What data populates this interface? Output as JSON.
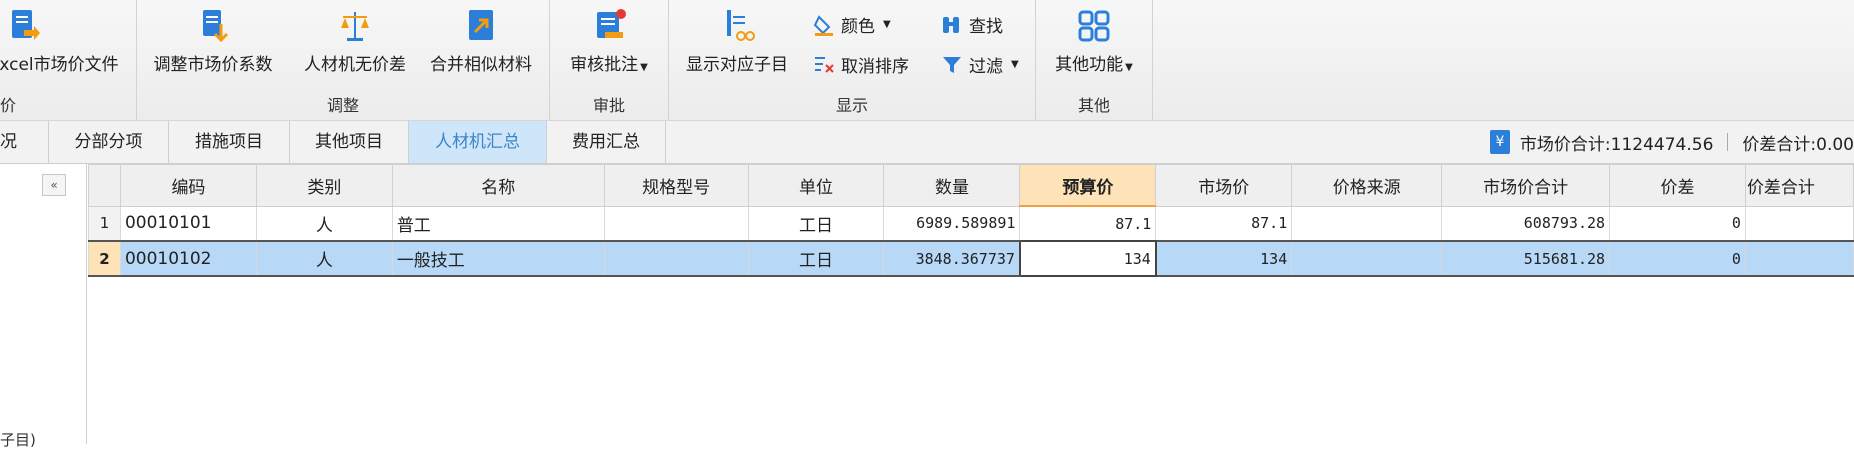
{
  "ribbon": {
    "groups": [
      {
        "title": "价"
      },
      {
        "title": "调整"
      },
      {
        "title": "审批"
      },
      {
        "title": "显示"
      },
      {
        "title": "其他"
      }
    ],
    "buttons": {
      "import_excel": "xcel市场价文件",
      "adjust_coef": "调整市场价系数",
      "no_price_diff": "人材机无价差",
      "merge_similar": "合并相似材料",
      "review_annotate": "审核批注",
      "show_child": "显示对应子目",
      "color": "颜色",
      "find": "查找",
      "cancel_sort": "取消排序",
      "filter": "过滤",
      "other_functions": "其他功能"
    }
  },
  "tabs": [
    {
      "label": "况"
    },
    {
      "label": "分部分项"
    },
    {
      "label": "措施项目"
    },
    {
      "label": "其他项目"
    },
    {
      "label": "人材机汇总"
    },
    {
      "label": "费用汇总"
    }
  ],
  "totals": {
    "icon": "yen-icon",
    "market_total": "市场价合计:1124474.56",
    "diff_total": "价差合计:0.00"
  },
  "left_panel": {
    "collapse_glyph": "«",
    "hint": "子目)"
  },
  "table": {
    "columns": [
      "编码",
      "类别",
      "名称",
      "规格型号",
      "单位",
      "数量",
      "预算价",
      "市场价",
      "价格来源",
      "市场价合计",
      "价差",
      "价差合计"
    ],
    "rows": [
      {
        "n": "1",
        "code": "00010101",
        "type": "人",
        "name": "普工",
        "spec": "",
        "unit": "工日",
        "qty": "6989.589891",
        "budget": "87.1",
        "market": "87.1",
        "source": "",
        "market_total": "608793.28",
        "diff": "0",
        "diff_total": ""
      },
      {
        "n": "2",
        "code": "00010102",
        "type": "人",
        "name": "一般技工",
        "spec": "",
        "unit": "工日",
        "qty": "3848.367737",
        "budget": "134",
        "market": "134",
        "source": "",
        "market_total": "515681.28",
        "diff": "0",
        "diff_total": ""
      }
    ]
  },
  "colors": {
    "accent": "#3a86c8",
    "selected_row": "#b8d8f8",
    "highlight_header": "#ffe3b8"
  }
}
